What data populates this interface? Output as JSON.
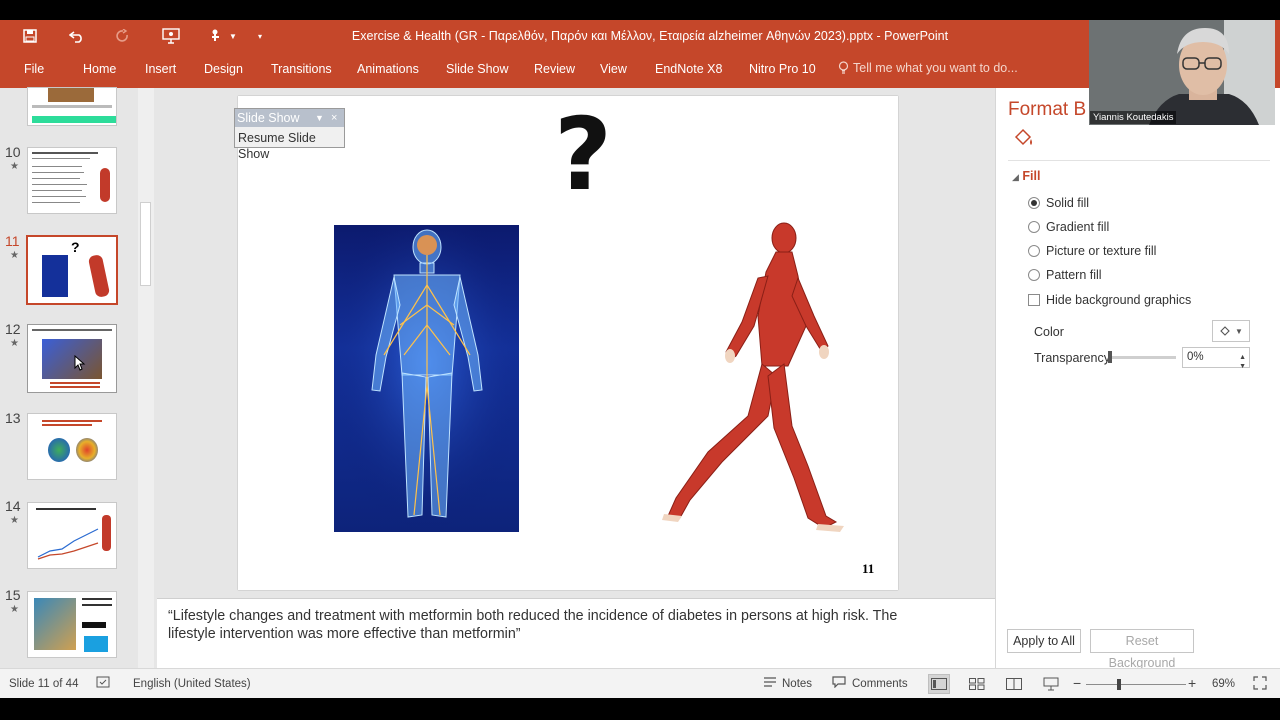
{
  "window": {
    "title": "Exercise & Health (GR - Παρελθόν, Παρόν και Μέλλον, Εταιρεία alzheimer Αθηνών 2023).pptx - PowerPoint"
  },
  "quick_access": {
    "save_icon": "save-icon",
    "undo_icon": "undo-icon",
    "redo_icon": "redo-icon",
    "present_icon": "present-icon",
    "touch_icon": "touch-mode-icon",
    "customize_icon": "customize-icon"
  },
  "ribbon": {
    "tabs": [
      "File",
      "Home",
      "Insert",
      "Design",
      "Transitions",
      "Animations",
      "Slide Show",
      "Review",
      "View",
      "EndNote X8",
      "Nitro Pro 10"
    ],
    "tell_me": "Tell me what you want to do..."
  },
  "thumbnails": [
    {
      "num": "10",
      "star": "★"
    },
    {
      "num": "11",
      "star": "★"
    },
    {
      "num": "12",
      "star": "★"
    },
    {
      "num": "13",
      "star": ""
    },
    {
      "num": "14",
      "star": "★"
    },
    {
      "num": "15",
      "star": "★"
    }
  ],
  "slideshow_toolbar": {
    "title": "Slide Show",
    "item": "Resume Slide Show"
  },
  "slide": {
    "question_mark": "?",
    "number": "11"
  },
  "notes": {
    "text": "“Lifestyle changes and treatment with metformin both reduced the incidence of diabetes in persons at high risk. The lifestyle intervention was more effective than metformin”"
  },
  "format_pane": {
    "title": "Format B",
    "section": "Fill",
    "options": [
      {
        "label": "Solid fill",
        "selected": true
      },
      {
        "label": "Gradient fill",
        "selected": false
      },
      {
        "label": "Picture or texture fill",
        "selected": false
      },
      {
        "label": "Pattern fill",
        "selected": false
      }
    ],
    "hide_bg": "Hide background graphics",
    "color_label": "Color",
    "transparency_label": "Transparency",
    "transparency_value": "0%",
    "apply_all": "Apply to All",
    "reset_bg": "Reset Background"
  },
  "webcam": {
    "name": "Yiannis Koutedakis"
  },
  "statusbar": {
    "slide_info": "Slide 11 of 44",
    "language": "English (United States)",
    "notes": "Notes",
    "comments": "Comments",
    "zoom": "69%"
  },
  "colors": {
    "accent": "#c5472a",
    "pane_bg": "#e6e6e6"
  }
}
